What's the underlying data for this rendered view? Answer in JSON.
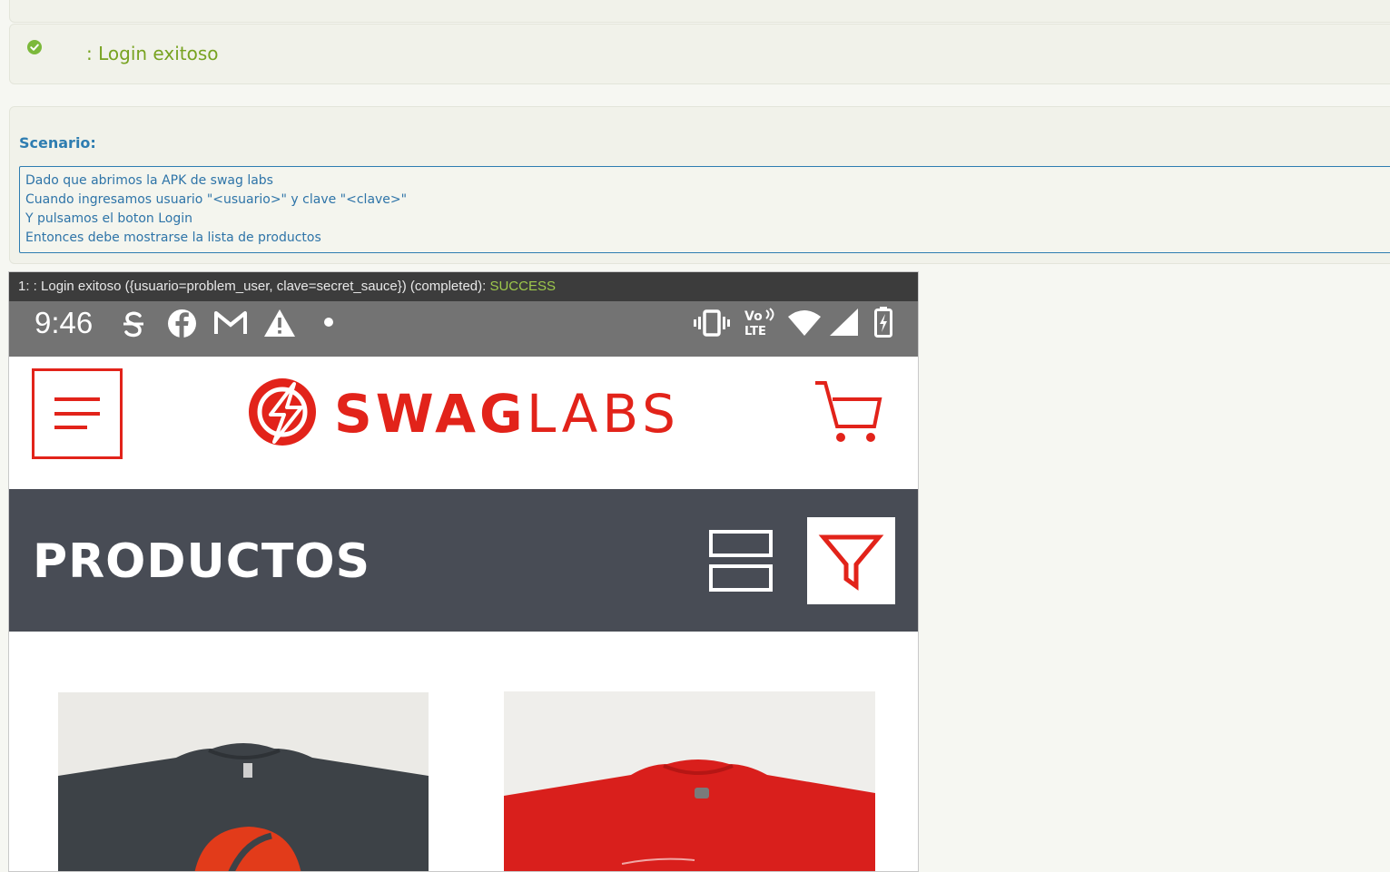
{
  "report": {
    "result_title": ": Login exitoso",
    "scenario_label": "Scenario:",
    "steps": [
      "Dado que abrimos la APK de swag labs",
      "Cuando ingresamos usuario \"<usuario>\" y clave \"<clave>\"",
      "Y pulsamos el boton Login",
      "Entonces debe mostrarse la lista de productos"
    ],
    "screenshot_caption": "1: : Login exitoso ({usuario=problem_user, clave=secret_sauce}) (completed): ",
    "screenshot_status": "SUCCESS"
  },
  "device": {
    "time": "9:46",
    "left_icons": [
      "strikethrough-s-icon",
      "facebook-icon",
      "gmail-icon",
      "warning-icon",
      "dot-icon"
    ],
    "right_icons": [
      "vibrate-icon",
      "volte-icon",
      "wifi-icon",
      "signal-icon",
      "battery-charging-icon"
    ],
    "volte_label_top": "Vo",
    "volte_label_bottom": "LTE"
  },
  "app": {
    "logo_bold": "SWAG",
    "logo_light": "LABS",
    "section_title": "PRODUCTOS",
    "products": [
      "dark-tshirt",
      "red-tshirt"
    ]
  },
  "colors": {
    "brand_red": "#e2231a",
    "success_green": "#78a321",
    "scenario_blue": "#2e7db1",
    "header_dark": "#484c55"
  }
}
